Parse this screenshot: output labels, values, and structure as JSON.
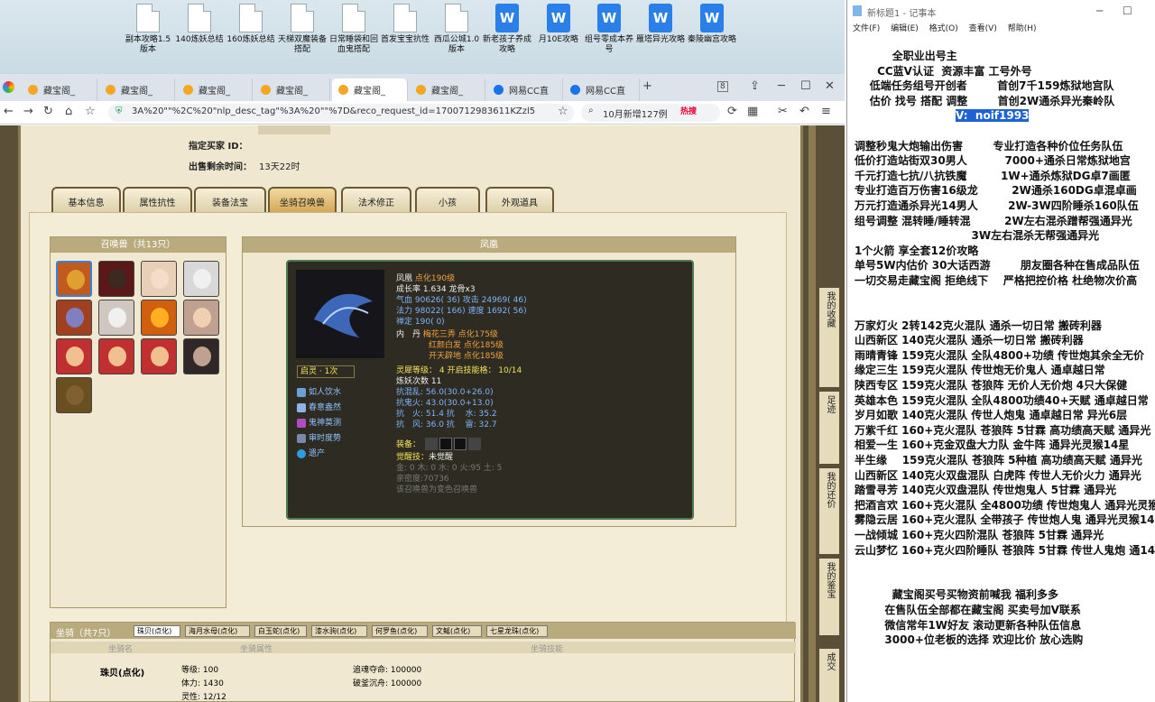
{
  "desktop": {
    "icons": [
      {
        "label": "副本攻略1.5版本",
        "type": "doc"
      },
      {
        "label": "140炼妖总结",
        "type": "doc"
      },
      {
        "label": "160炼妖总结",
        "type": "doc"
      },
      {
        "label": "天梯双魔装备搭配",
        "type": "doc"
      },
      {
        "label": "日常睡袋和回血鬼搭配",
        "type": "doc"
      },
      {
        "label": "首发宝宝抗性",
        "type": "doc"
      },
      {
        "label": "西瓜公城1.0版本",
        "type": "doc"
      },
      {
        "label": "新老孩子养成攻略",
        "type": "wps"
      },
      {
        "label": "月10E攻略",
        "type": "wps"
      },
      {
        "label": "组号零成本养号",
        "type": "wps"
      },
      {
        "label": "雁塔异光攻略",
        "type": "wps"
      },
      {
        "label": "秦陵幽宫攻略",
        "type": "wps"
      }
    ]
  },
  "browser": {
    "tabs": [
      {
        "label": "藏宝阁_",
        "icon": "cbg"
      },
      {
        "label": "藏宝阁_",
        "icon": "cbg"
      },
      {
        "label": "藏宝阁_",
        "icon": "cbg"
      },
      {
        "label": "藏宝阁_",
        "icon": "cbg"
      },
      {
        "label": "藏宝阁_",
        "icon": "cbg",
        "active": true
      },
      {
        "label": "藏宝阁_",
        "icon": "cbg"
      },
      {
        "label": "网易CC直",
        "icon": "cc"
      },
      {
        "label": "网易CC直",
        "icon": "cc"
      }
    ],
    "url": "3A%20\"\"%2C%20\"nlp_desc_tag\"%3A%20\"\"%7D&reco_request_id=1700712983611KZzl5",
    "search": "10月新增127例",
    "hot": "热搜",
    "badge": "8"
  },
  "page": {
    "buyer_label": "指定买家 ID：",
    "time_label": "出售剩余时间：",
    "time_value": "13天22时",
    "tabs": [
      "基本信息",
      "属性抗性",
      "装备法宝",
      "坐骑召唤兽",
      "法术修正",
      "小孩",
      "外观道具"
    ],
    "pet_list_title": "召唤兽（共13只）",
    "detail_title": "凤凰",
    "pet": {
      "name": "凤凰",
      "level": "点化190级",
      "growth": "成长率 1.634 龙骨x3",
      "hp_label": "气血",
      "hp": "90626( 36)",
      "atk_label": "攻击",
      "atk": "24969( 46)",
      "mp_label": "法力",
      "mp": "98022( 166)",
      "spd_label": "速度",
      "spd": "1692( 56)",
      "def_label": "禅定",
      "def": "190( 0)",
      "inner_label": "内　丹",
      "inner1": "梅花三弄 点化175级",
      "inner2": "红颜白发 点化185级",
      "inner3": "开天辟地 点化185级",
      "spirit": "灵犀等级： 4 开启技能格： 10/14",
      "refine": "炼妖次数 11",
      "res1": "抗混乱: 56.0(30.0+26.0)",
      "res2": "抗鬼火: 43.0(30.0+13.0)",
      "res3": "抗　火: 51.4 抗　 水: 35.2",
      "res4": "抗　风: 36.0 抗　 雷: 32.7",
      "equip_label": "装备：",
      "awaken_label": "觉醒技：",
      "awaken_value": "未觉醒",
      "elements": "金: 0 木: 0 水: 0 火:95 土: 5",
      "proficiency": "亲密度:70736",
      "variant": "该召唤兽为变色召唤兽",
      "qiling": "启灵 · 1次",
      "skills": [
        "如人饮水",
        "春意盎然",
        "鬼神莫测",
        "审时度势",
        "遗产"
      ]
    },
    "mount_title": "坐骑（共7只）",
    "mount_tabs": [
      "珠贝(点化)",
      "海月水母(点化)",
      "白玉蛇(点化)",
      "漆水驹(点化)",
      "何罗鱼(点化)",
      "文鳐(点化)",
      "七星龙珠(点化)"
    ],
    "mount_headers": [
      "坐骑名",
      "坐骑属性",
      "坐骑技能"
    ],
    "mount": {
      "name": "珠贝(点化)",
      "level": "等级: 100",
      "hp": "体力: 1430",
      "spirit": "灵性: 12/12",
      "skill1": "追魂夺命: 100000",
      "skill2": "破釜沉舟: 100000"
    },
    "side_texts": [
      "我的收藏",
      "足迹",
      "我的还价",
      "我的鉴宝",
      "成交"
    ]
  },
  "notepad": {
    "title": "新标题1 - 记事本",
    "menu": [
      "文件(F)",
      "编辑(E)",
      "格式(O)",
      "查看(V)",
      "帮助(H)"
    ],
    "lines": [
      "          全职业出号主",
      "      CC蓝V认证  资源丰富 工号外号",
      "    低端任务组号开创者        首创7千159炼狱地宫队",
      "    估价 找号 搭配 调整        首创2W通杀异光秦岭队",
      "",
      "调整秒鬼大炮输出伤害        专业打造各种价位任务队伍",
      "低价打造站街双30男人          7000+通杀日常炼狱地宫",
      "千元打造七抗/八抗铁魔         1W+通杀炼狱DG卓7画匿",
      "专业打造百万伤害16级龙         2W通杀160DG卓混卓画",
      "万元打造通杀异光14男人        2W-3W四阶睡杀160队伍",
      "组号调整 混转睡/睡转混         2W左右混杀蹭帮强通异光",
      "                               3W左右混杀无帮强通异光",
      "1个火箭 享全套12价攻略",
      "单号5W内估价 30大话西游        朋友圈各种在售成品队伍",
      "一切交易走藏宝阁 拒绝线下    严格把控价格 杜绝物次价高",
      "",
      "",
      "万家灯火 2转142克火混队 通杀一切日常 搬砖利器",
      "山西新区 140克火混队 通杀一切日常 搬砖利器",
      "雨晴青锋 159克火混队 全队4800+功绩 传世炮其余全无价",
      "缘定三生 159克火混队 传世炮无价鬼人 通卓越日常",
      "陕西专区 159克火混队 苍狼阵 无价人无价炮 4只大保健",
      "英雄本色 159克火混队 全队4800功绩40+天赋 通卓越日常",
      "岁月如歌 140克火混队 传世人炮鬼 通卓越日常 异光6层",
      "万紫千红 160+克火混队 苍狼阵 5甘霖 高功绩高天赋 通异光",
      "相爱一生 160+克金双盘大力队 金牛阵 通异光灵猴14星",
      "半生缘    159克火混队 苍狼阵 5种植 高功绩高天赋 通异光",
      "山西新区 140克火双盘混队 白虎阵 传世人无价火力 通异光",
      "踏雪寻芳 140克火双盘混队 传世炮鬼人 5甘霖 通异光",
      "把酒言欢 160+克火混队 全4800功绩 传世炮鬼人 通异光灵猴",
      "雾隐云居 160+克火混队 全带孩子 传世炮人鬼 通异光灵猴14",
      "一战倾城 160+克火四阶混队 苍狼阵 5甘霖 通异光",
      "云山梦忆 160+克火四阶睡队 苍狼阵 5甘霖 传世人鬼炮 通14",
      "",
      "",
      "          藏宝阁买号买物资前喊我 福利多多",
      "        在售队伍全部都在藏宝阁 买卖号加V联系",
      "        微信常年1W好友 滚动更新各种队伍信息",
      "        3000+位老板的选择 欢迎比价 放心选购"
    ],
    "highlight": "V:  noif1993"
  }
}
